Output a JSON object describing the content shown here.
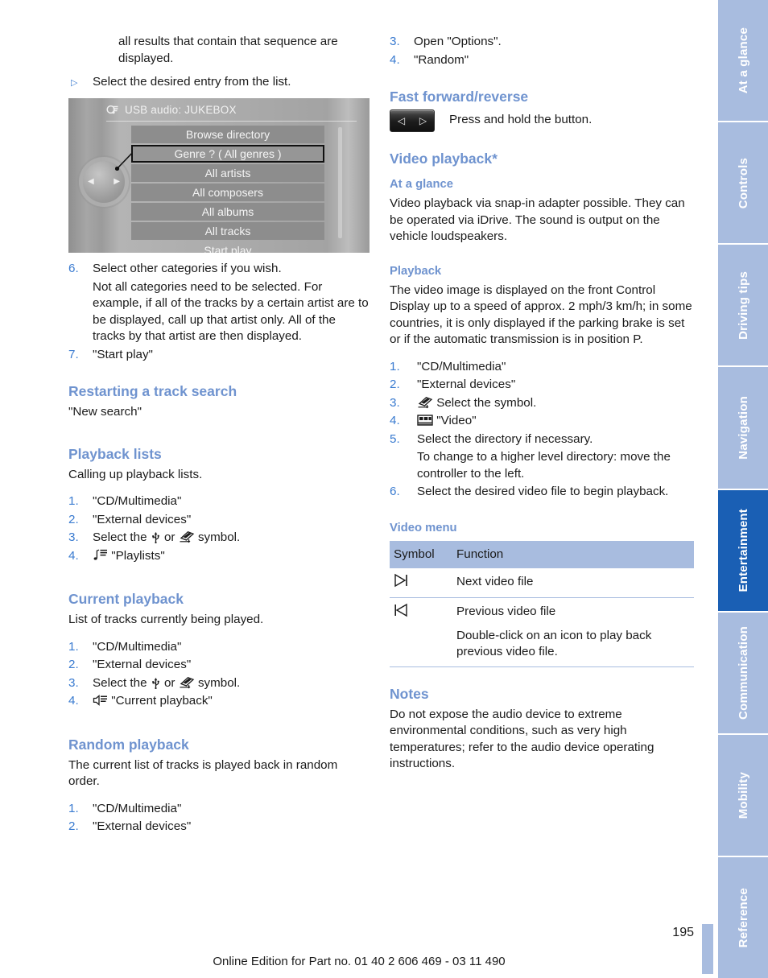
{
  "page": {
    "number": "195",
    "footer": "Online Edition for Part no. 01 40 2 606 469 - 03 11 490"
  },
  "colors": {
    "accent_heading": "#6f93cf",
    "tab_inactive": "#a8bcdf",
    "tab_active": "#1a5fb4",
    "list_number": "#3a7bd0",
    "table_header_bg": "#a8bcdf"
  },
  "tabs": [
    {
      "label": "At a glance",
      "active": false
    },
    {
      "label": "Controls",
      "active": false
    },
    {
      "label": "Driving tips",
      "active": false
    },
    {
      "label": "Navigation",
      "active": false
    },
    {
      "label": "Entertainment",
      "active": true
    },
    {
      "label": "Communication",
      "active": false
    },
    {
      "label": "Mobility",
      "active": false
    },
    {
      "label": "Reference",
      "active": false
    }
  ],
  "left_column": {
    "carryover_text": "all results that contain that sequence are displayed.",
    "bullet_1": "Select the desired entry from the list.",
    "idrive": {
      "title": "USB audio: JUKEBOX",
      "title_icon": "usb-audio-icon",
      "items": [
        {
          "label": "Browse directory",
          "selected": false
        },
        {
          "label": "Genre ? ( All genres )",
          "selected": true
        },
        {
          "label": "All artists",
          "selected": false
        },
        {
          "label": "All composers",
          "selected": false
        },
        {
          "label": "All albums",
          "selected": false
        },
        {
          "label": "All tracks",
          "selected": false
        }
      ],
      "footer_item": "Start play"
    },
    "step_6_num": "6.",
    "step_6_text": "Select other categories if you wish.",
    "step_6_note": "Not all categories need to be selected. For example, if all of the tracks by a certain artist are to be displayed, call up that artist only. All of the tracks by that artist are then displayed.",
    "step_7_num": "7.",
    "step_7_text": "\"Start play\"",
    "restart": {
      "heading": "Restarting a track search",
      "body": "\"New search\""
    },
    "playback_lists": {
      "heading": "Playback lists",
      "intro": "Calling up playback lists.",
      "steps": [
        {
          "num": "1.",
          "text": "\"CD/Multimedia\""
        },
        {
          "num": "2.",
          "text": "\"External devices\""
        },
        {
          "num": "3.",
          "text_before": "Select the ",
          "icon_a": "usb-icon",
          "text_mid": " or ",
          "icon_b": "snap-in-adapter-icon",
          "text_after": " symbol."
        },
        {
          "num": "4.",
          "icon": "playlist-icon",
          "text": "\"Playlists\""
        }
      ]
    },
    "current_playback": {
      "heading": "Current playback",
      "intro": "List of tracks currently being played.",
      "steps": [
        {
          "num": "1.",
          "text": "\"CD/Multimedia\""
        },
        {
          "num": "2.",
          "text": "\"External devices\""
        },
        {
          "num": "3.",
          "text_before": "Select the ",
          "icon_a": "usb-icon",
          "text_mid": " or ",
          "icon_b": "snap-in-adapter-icon",
          "text_after": " symbol."
        },
        {
          "num": "4.",
          "icon": "speaker-icon",
          "text": "\"Current playback\""
        }
      ]
    },
    "random_playback": {
      "heading": "Random playback",
      "intro": "The current list of tracks is played back in random order.",
      "steps": [
        {
          "num": "1.",
          "text": "\"CD/Multimedia\""
        },
        {
          "num": "2.",
          "text": "\"External devices\""
        }
      ]
    }
  },
  "right_column": {
    "random_steps_cont": [
      {
        "num": "3.",
        "text": "Open \"Options\"."
      },
      {
        "num": "4.",
        "text": "\"Random\""
      }
    ],
    "fast_forward": {
      "heading": "Fast forward/reverse",
      "button_icon": "fast-forward-reverse-button",
      "text": "Press and hold the button."
    },
    "video_playback": {
      "heading": "Video playback*",
      "at_a_glance": {
        "heading": "At a glance",
        "body": "Video playback via snap-in adapter possible. They can be operated via iDrive. The sound is output on the vehicle loudspeakers."
      },
      "playback": {
        "heading": "Playback",
        "body": "The video image is displayed on the front Control Display up to a speed of approx. 2 mph/3 km/h; in some countries, it is only displayed if the parking brake is set or if the automatic transmission is in position P.",
        "steps": [
          {
            "num": "1.",
            "text": "\"CD/Multimedia\""
          },
          {
            "num": "2.",
            "text": "\"External devices\""
          },
          {
            "num": "3.",
            "icon": "snap-in-adapter-icon",
            "text": "Select the symbol."
          },
          {
            "num": "4.",
            "icon": "film-strip-icon",
            "text": "\"Video\""
          },
          {
            "num": "5.",
            "text": "Select the directory if necessary.",
            "note": "To change to a higher level directory: move the controller to the left."
          },
          {
            "num": "6.",
            "text": "Select the desired video file to begin playback."
          }
        ]
      },
      "video_menu": {
        "heading": "Video menu",
        "columns": [
          "Symbol",
          "Function"
        ],
        "rows": [
          {
            "symbol": "next-video-icon",
            "symbol_glyph": "▷|",
            "lines": [
              "Next video file"
            ]
          },
          {
            "symbol": "previous-video-icon",
            "symbol_glyph": "|◁",
            "lines": [
              "Previous video file",
              "Double-click on an icon to play back previous video file."
            ]
          }
        ]
      },
      "notes": {
        "heading": "Notes",
        "body": "Do not expose the audio device to extreme environmental conditions, such as very high temperatures; refer to the audio device operating instructions."
      }
    }
  }
}
